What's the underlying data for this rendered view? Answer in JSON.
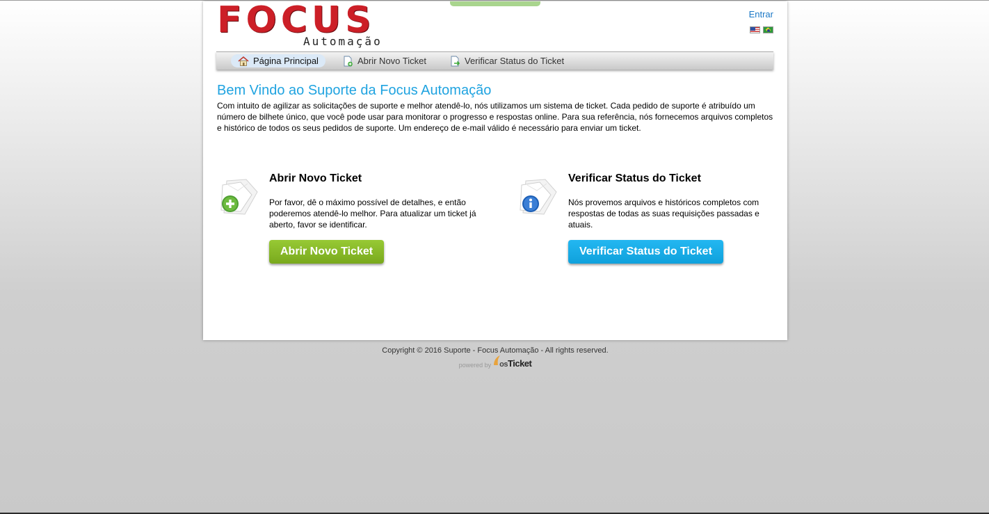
{
  "header": {
    "logo_text": "FOCUS",
    "logo_subtext": "Automação",
    "login_label": "Entrar",
    "languages": [
      "en-us",
      "pt-br"
    ]
  },
  "nav": {
    "items": [
      {
        "label": "Página Principal",
        "icon": "home-icon",
        "active": true
      },
      {
        "label": "Abrir Novo Ticket",
        "icon": "new-ticket-icon",
        "active": false
      },
      {
        "label": "Verificar Status do Ticket",
        "icon": "ticket-status-icon",
        "active": false
      }
    ]
  },
  "welcome": {
    "title": "Bem Vindo ao Suporte da Focus Automação",
    "text": "Com intuito de agilizar as solicitações de suporte e melhor atendê-lo, nós utilizamos um sistema de ticket. Cada pedido de suporte é atribuído um número de bilhete único, que você pode usar para monitorar o progresso e respostas online. Para sua referência, nós fornecemos arquivos completos e histórico de todos os seus pedidos de suporte. Um endereço de e-mail válido é necessário para enviar um ticket."
  },
  "cards": {
    "new_ticket": {
      "title": "Abrir Novo Ticket",
      "description": "Por favor, dê o máximo possível de detalhes, e então poderemos atendê-lo melhor. Para atualizar um ticket já aberto, favor se identificar.",
      "button": "Abrir Novo Ticket",
      "color": "#84b624"
    },
    "check_status": {
      "title": "Verificar Status do Ticket",
      "description": "Nós provemos arquivos e históricos completos com respostas de todas as suas requisições passadas e atuais.",
      "button": "Verificar Status do Ticket",
      "color": "#14a9e6"
    }
  },
  "footer": {
    "copyright": "Copyright © 2016 Suporte - Focus Automação - All rights reserved.",
    "powered_by": "powered by",
    "osticket_os": "os",
    "osticket_ticket": "Ticket"
  },
  "colors": {
    "title_blue": "#1fa3e0",
    "logo_red": "#cc1f27",
    "link_blue": "#1b78c6"
  }
}
